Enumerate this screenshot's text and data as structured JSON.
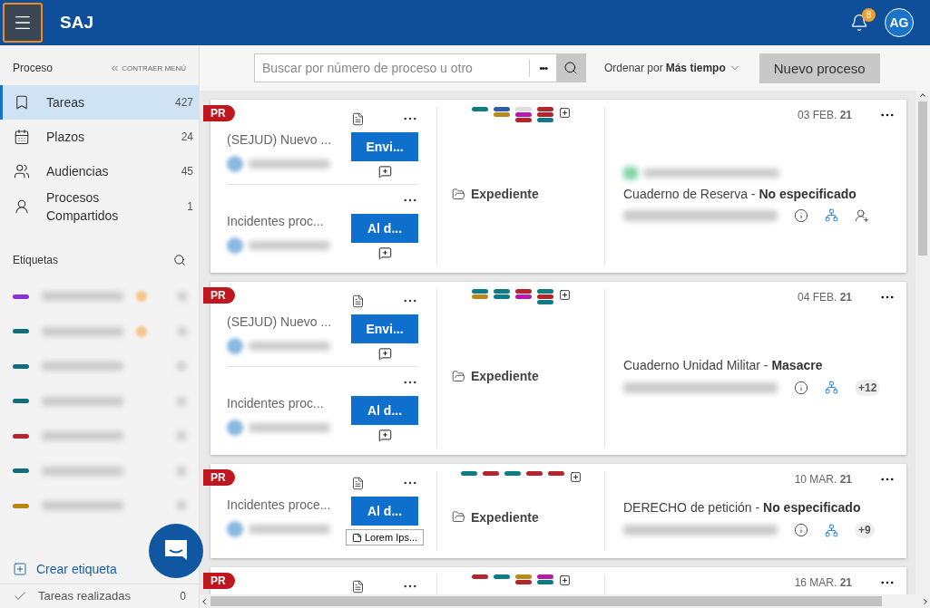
{
  "header": {
    "title": "SAJ",
    "notifications": "8",
    "avatar": "AG"
  },
  "sidebar": {
    "section_title": "Proceso",
    "collapse": "CONTRAER MENÚ",
    "items": [
      {
        "kind": "tasks",
        "label": "Tareas",
        "count": "427",
        "selected": true
      },
      {
        "kind": "deadlines",
        "label": "Plazos",
        "count": "24",
        "selected": false
      },
      {
        "kind": "hearings",
        "label": "Audiencias",
        "count": "45",
        "selected": false
      },
      {
        "kind": "shared",
        "label": "Procesos Compartidos",
        "count": "1",
        "selected": false
      }
    ],
    "labels_title": "Etiquetas",
    "labels": [
      {
        "color": "#8b2fd6",
        "flagged": true
      },
      {
        "color": "#0e6f7a",
        "flagged": true
      },
      {
        "color": "#0e6f7a",
        "flagged": false
      },
      {
        "color": "#0e6f7a",
        "flagged": false
      },
      {
        "color": "#b3262f",
        "flagged": false
      },
      {
        "color": "#0e6f7a",
        "flagged": false
      },
      {
        "color": "#b8860b",
        "flagged": false
      }
    ],
    "create_label": "Crear etiqueta",
    "done": {
      "label": "Tareas realizadas",
      "count": "0"
    }
  },
  "toolbar": {
    "search": {
      "placeholder": "Buscar por número de proceso u otro"
    },
    "more": "•••",
    "sort_label": "Ordenar por",
    "sort_value": "Más tiempo",
    "new_button": "Nuevo proceso"
  },
  "cards": [
    {
      "badge": "PR",
      "sections": [
        {
          "title": "(SEJUD) Nuevo ...",
          "action": "Envi...",
          "info": true
        },
        {
          "title": "Incidentes proc...",
          "action": "Al d...",
          "info": false
        }
      ],
      "tags": [
        {
          "stripes": [
            {
              "color": "#0f7b84"
            }
          ]
        },
        {
          "stripes": [
            {
              "color": "#2e5ea8"
            },
            {
              "color": "#b78a1b"
            }
          ]
        },
        {
          "stripes": [
            {
              "color": "#dddddd"
            },
            {
              "color": "#b51aa8"
            },
            {
              "color": "#b3242b"
            }
          ]
        },
        {
          "stripes": [
            {
              "color": "#b3242b"
            },
            {
              "color": "#b3242b"
            },
            {
              "color": "#0f7b84"
            }
          ]
        }
      ],
      "folder": "Expediente",
      "date": "03 FEB. **21**",
      "owner": true,
      "case": "Cuaderno de Reserva - **No especificado**",
      "share": true
    },
    {
      "badge": "PR",
      "sections": [
        {
          "title": "(SEJUD) Nuevo ...",
          "action": "Envi...",
          "info": true
        },
        {
          "title": "Incidentes proc...",
          "action": "Al d...",
          "info": false
        }
      ],
      "tags": [
        {
          "stripes": [
            {
              "color": "#0f7b84"
            },
            {
              "color": "#b78a1b"
            }
          ]
        },
        {
          "stripes": [
            {
              "color": "#0f7b84"
            },
            {
              "color": "#0f7b84"
            }
          ]
        },
        {
          "stripes": [
            {
              "color": "#b3242b"
            },
            {
              "color": "#b51aa8"
            }
          ]
        },
        {
          "stripes": [
            {
              "color": "#0f7b84"
            },
            {
              "color": "#b3242b"
            },
            {
              "color": "#0f7b84"
            }
          ]
        }
      ],
      "folder": "Expediente",
      "date": "04 FEB. **21**",
      "owner": false,
      "case": "Cuaderno Unidad Militar - **Masacre**",
      "share": false,
      "extra": "+12"
    },
    {
      "badge": "PR",
      "sections": [
        {
          "title": "Incidentes proce...",
          "action": "Al d...",
          "info": true,
          "note": "Lorem Ips..."
        }
      ],
      "tags": [
        {
          "stripes": [
            {
              "color": "#0f7b84"
            }
          ]
        },
        {
          "stripes": [
            {
              "color": "#b3242b"
            }
          ]
        },
        {
          "stripes": [
            {
              "color": "#0f7b84"
            }
          ]
        },
        {
          "stripes": [
            {
              "color": "#b3242b"
            }
          ]
        },
        {
          "stripes": [
            {
              "color": "#b3242b"
            }
          ]
        }
      ],
      "folder": "Expediente",
      "date": "10 MAR. **21**",
      "owner": false,
      "case": "DERECHO de petición - **No especificado**",
      "share": false,
      "extra": "+9"
    },
    {
      "badge": "PR",
      "sections": [
        {
          "info": true
        }
      ],
      "tags": [
        {
          "stripes": [
            {
              "color": "#b3242b"
            }
          ]
        },
        {
          "stripes": [
            {
              "color": "#0f7b84"
            }
          ]
        },
        {
          "stripes": [
            {
              "color": "#b78a1b"
            },
            {
              "color": "#b3242b"
            }
          ]
        },
        {
          "stripes": [
            {
              "color": "#b51aa8"
            },
            {
              "color": "#0f7b84"
            }
          ]
        }
      ],
      "date": "16 MAR. **21**",
      "owner": false,
      "share": false
    }
  ]
}
